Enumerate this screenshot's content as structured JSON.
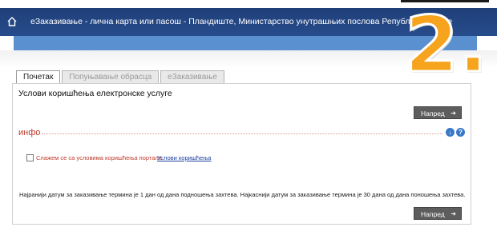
{
  "header": {
    "title": "еЗаказивање - лична карта или пасош - Пландиште, Министарство унутрашњих послова Републике Србије"
  },
  "step_badge": "2.",
  "tabs": [
    {
      "label": "Почетак",
      "active": true
    },
    {
      "label": "Попуњавање обрасца",
      "active": false
    },
    {
      "label": "еЗаказивање",
      "active": false
    }
  ],
  "panel": {
    "title": "Услови коришћења електронске услуге",
    "next_top_label": "Напред",
    "section_label": "инфо",
    "agree_label": "Слажем се са условима коришћења портала",
    "terms_link": "Услови коришћења",
    "note": "Најранији датум за заказивање термина је 1 дан од дана подношења захтева. Најкаснији датум за заказивање термина је 30 дана од дана поношења захтева.",
    "next_bottom_label": "Напред"
  },
  "icons": {
    "home": "home-icon",
    "download": "download-icon",
    "help": "help-icon",
    "next_arrow": "arrow-right-icon"
  },
  "colors": {
    "header_bg": "#274c8c",
    "accent_orange": "#f6a31e",
    "section_red": "#c0392b",
    "button_bg": "#5d5d5d"
  }
}
